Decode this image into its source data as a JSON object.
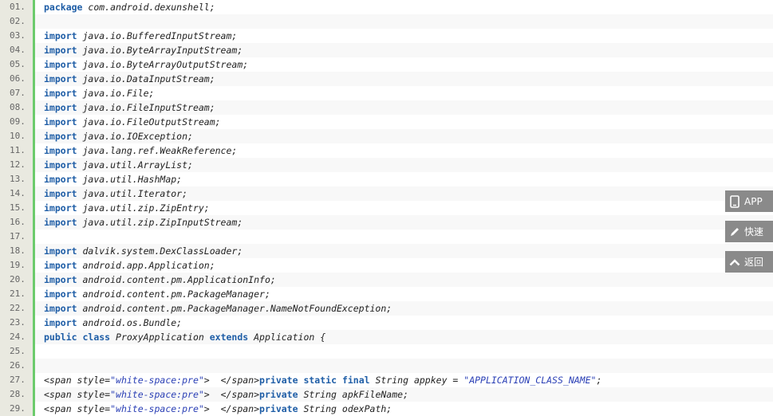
{
  "lines": [
    {
      "no": "01.",
      "parts": [
        [
          "kw",
          "package"
        ],
        [
          "t",
          " com.android.dexunshell;"
        ]
      ]
    },
    {
      "no": "02.",
      "parts": []
    },
    {
      "no": "03.",
      "parts": [
        [
          "kw",
          "import"
        ],
        [
          "t",
          " java.io.BufferedInputStream;"
        ]
      ]
    },
    {
      "no": "04.",
      "parts": [
        [
          "kw",
          "import"
        ],
        [
          "t",
          " java.io.ByteArrayInputStream;"
        ]
      ]
    },
    {
      "no": "05.",
      "parts": [
        [
          "kw",
          "import"
        ],
        [
          "t",
          " java.io.ByteArrayOutputStream;"
        ]
      ]
    },
    {
      "no": "06.",
      "parts": [
        [
          "kw",
          "import"
        ],
        [
          "t",
          " java.io.DataInputStream;"
        ]
      ]
    },
    {
      "no": "07.",
      "parts": [
        [
          "kw",
          "import"
        ],
        [
          "t",
          " java.io.File;"
        ]
      ]
    },
    {
      "no": "08.",
      "parts": [
        [
          "kw",
          "import"
        ],
        [
          "t",
          " java.io.FileInputStream;"
        ]
      ]
    },
    {
      "no": "09.",
      "parts": [
        [
          "kw",
          "import"
        ],
        [
          "t",
          " java.io.FileOutputStream;"
        ]
      ]
    },
    {
      "no": "10.",
      "parts": [
        [
          "kw",
          "import"
        ],
        [
          "t",
          " java.io.IOException;"
        ]
      ]
    },
    {
      "no": "11.",
      "parts": [
        [
          "kw",
          "import"
        ],
        [
          "t",
          " java.lang.ref.WeakReference;"
        ]
      ]
    },
    {
      "no": "12.",
      "parts": [
        [
          "kw",
          "import"
        ],
        [
          "t",
          " java.util.ArrayList;"
        ]
      ]
    },
    {
      "no": "13.",
      "parts": [
        [
          "kw",
          "import"
        ],
        [
          "t",
          " java.util.HashMap;"
        ]
      ]
    },
    {
      "no": "14.",
      "parts": [
        [
          "kw",
          "import"
        ],
        [
          "t",
          " java.util.Iterator;"
        ]
      ]
    },
    {
      "no": "15.",
      "parts": [
        [
          "kw",
          "import"
        ],
        [
          "t",
          " java.util.zip.ZipEntry;"
        ]
      ]
    },
    {
      "no": "16.",
      "parts": [
        [
          "kw",
          "import"
        ],
        [
          "t",
          " java.util.zip.ZipInputStream;"
        ]
      ]
    },
    {
      "no": "17.",
      "parts": []
    },
    {
      "no": "18.",
      "parts": [
        [
          "kw",
          "import"
        ],
        [
          "t",
          " dalvik.system.DexClassLoader;"
        ]
      ]
    },
    {
      "no": "19.",
      "parts": [
        [
          "kw",
          "import"
        ],
        [
          "t",
          " android.app.Application;"
        ]
      ]
    },
    {
      "no": "20.",
      "parts": [
        [
          "kw",
          "import"
        ],
        [
          "t",
          " android.content.pm.ApplicationInfo;"
        ]
      ]
    },
    {
      "no": "21.",
      "parts": [
        [
          "kw",
          "import"
        ],
        [
          "t",
          " android.content.pm.PackageManager;"
        ]
      ]
    },
    {
      "no": "22.",
      "parts": [
        [
          "kw",
          "import"
        ],
        [
          "t",
          " android.content.pm.PackageManager.NameNotFoundException;"
        ]
      ]
    },
    {
      "no": "23.",
      "parts": [
        [
          "kw",
          "import"
        ],
        [
          "t",
          " android.os.Bundle;"
        ]
      ]
    },
    {
      "no": "24.",
      "parts": [
        [
          "kw",
          "public"
        ],
        [
          "t",
          " "
        ],
        [
          "kw",
          "class"
        ],
        [
          "t",
          " ProxyApplication "
        ],
        [
          "kw",
          "extends"
        ],
        [
          "t",
          " Application {"
        ]
      ]
    },
    {
      "no": "25.",
      "parts": []
    },
    {
      "no": "26.",
      "parts": []
    },
    {
      "no": "27.",
      "parts": [
        [
          "t",
          "<span style="
        ],
        [
          "str",
          "\"white-space:pre\""
        ],
        [
          "t",
          ">  </span>"
        ],
        [
          "kw",
          "private"
        ],
        [
          "t",
          " "
        ],
        [
          "kw",
          "static"
        ],
        [
          "t",
          " "
        ],
        [
          "kw",
          "final"
        ],
        [
          "t",
          " String appkey = "
        ],
        [
          "str",
          "\"APPLICATION_CLASS_NAME\""
        ],
        [
          "t",
          ";"
        ]
      ]
    },
    {
      "no": "28.",
      "parts": [
        [
          "t",
          "<span style="
        ],
        [
          "str",
          "\"white-space:pre\""
        ],
        [
          "t",
          ">  </span>"
        ],
        [
          "kw",
          "private"
        ],
        [
          "t",
          " String apkFileName;"
        ]
      ]
    },
    {
      "no": "29.",
      "parts": [
        [
          "t",
          "<span style="
        ],
        [
          "str",
          "\"white-space:pre\""
        ],
        [
          "t",
          ">  </span>"
        ],
        [
          "kw",
          "private"
        ],
        [
          "t",
          " String odexPath;"
        ]
      ]
    }
  ],
  "side_buttons": [
    {
      "label": "APP",
      "icon": "phone-icon"
    },
    {
      "label": "快速",
      "icon": "pencil-icon"
    },
    {
      "label": "返回",
      "icon": "chevron-up-icon"
    }
  ]
}
